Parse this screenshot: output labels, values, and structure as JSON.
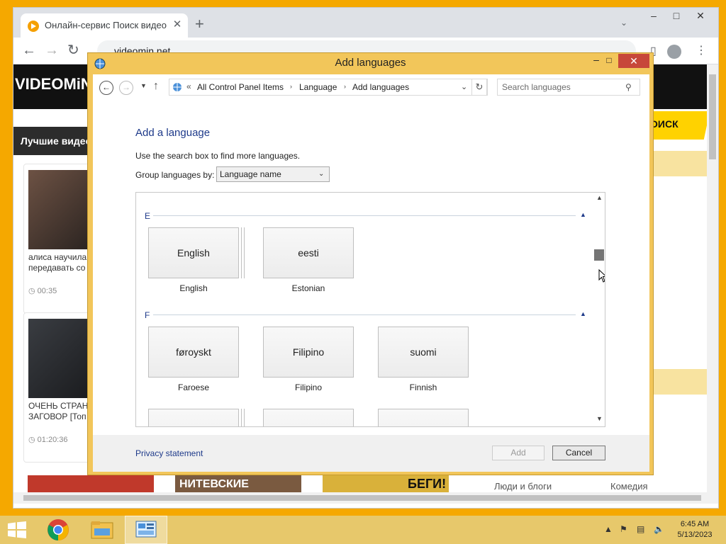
{
  "browser": {
    "tab_title": "Онлайн-сервис Поиск видео и",
    "url": "videomin.net",
    "site_logo": "VIDEOMiN",
    "search_button": "ОИСК",
    "best_videos": "Лучшие видео",
    "videos": [
      {
        "title": "алиса научила\nпередавать со",
        "duration": "00:35"
      },
      {
        "title": "ОЧЕНЬ СТРАН\nЗАГОВОР [Топ",
        "duration": "01:20:36"
      }
    ],
    "categories": [
      "Люди и блоги",
      "Комедия"
    ],
    "bottom_thumb_text": [
      "НИТЕВСКИЕ",
      "БЕГИ!"
    ]
  },
  "dialog": {
    "title": "Add languages",
    "breadcrumb": [
      "All Control Panel Items",
      "Language",
      "Add languages"
    ],
    "breadcrumb_prefix": "«",
    "search_placeholder": "Search languages",
    "heading": "Add a language",
    "description": "Use the search box to find more languages.",
    "group_label": "Group languages by:",
    "group_value": "Language name",
    "sections": [
      {
        "letter": "E",
        "languages": [
          {
            "native": "English",
            "name": "English",
            "stacked": true
          },
          {
            "native": "eesti",
            "name": "Estonian",
            "stacked": false
          }
        ]
      },
      {
        "letter": "F",
        "languages": [
          {
            "native": "føroyskt",
            "name": "Faroese",
            "stacked": false
          },
          {
            "native": "Filipino",
            "name": "Filipino",
            "stacked": false
          },
          {
            "native": "suomi",
            "name": "Finnish",
            "stacked": false
          }
        ]
      }
    ],
    "privacy_link": "Privacy statement",
    "add_button": "Add",
    "cancel_button": "Cancel"
  },
  "taskbar": {
    "time": "6:45 AM",
    "date": "5/13/2023"
  }
}
